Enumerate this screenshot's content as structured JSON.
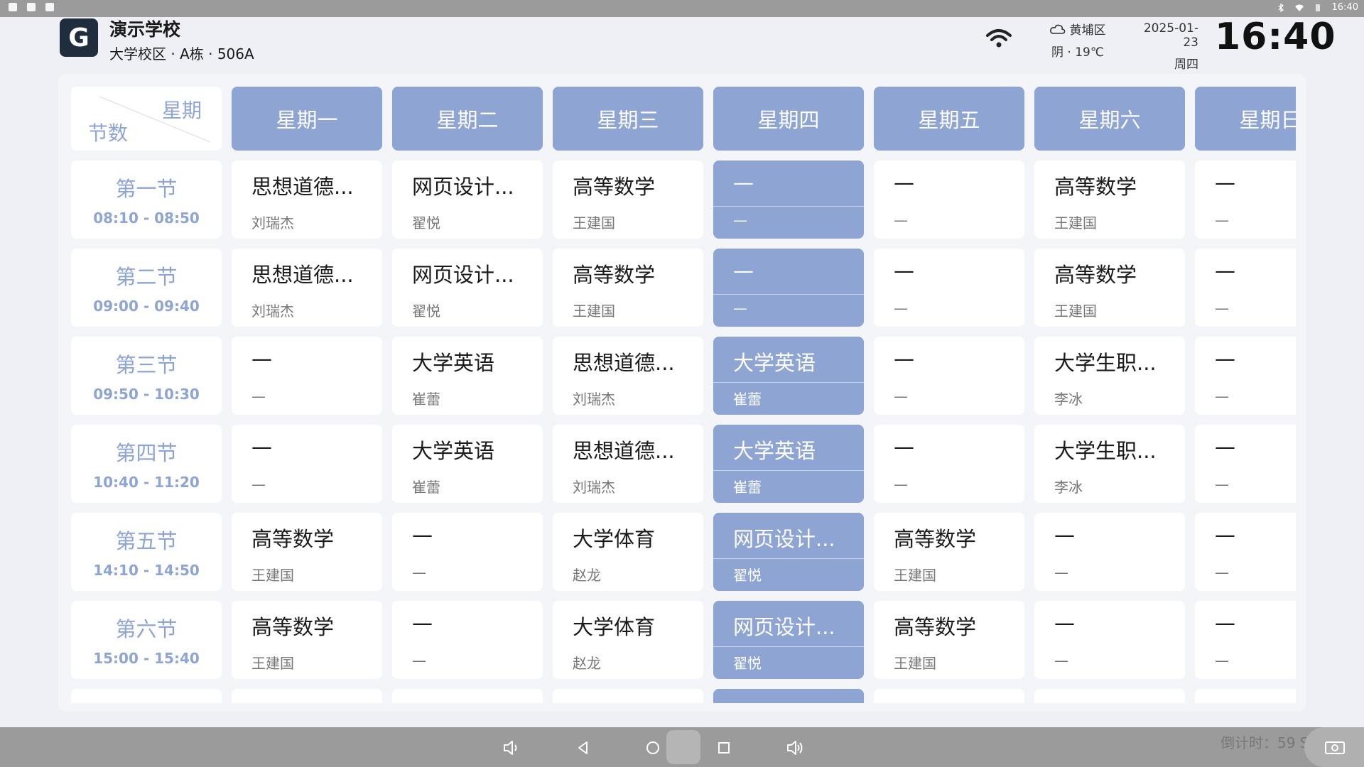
{
  "status_bar": {
    "time": "16:40"
  },
  "header": {
    "logo_letter": "G",
    "school_name": "演示学校",
    "location": "大学校区 · A栋 · 506A",
    "weather": {
      "district": "黄埔区",
      "condition": "阴 · 19℃"
    },
    "date": "2025-01-23",
    "weekday": "周四",
    "clock": "16:40"
  },
  "timetable": {
    "corner_top": "星期",
    "corner_bottom": "节数",
    "days": [
      "星期一",
      "星期二",
      "星期三",
      "星期四",
      "星期五",
      "星期六",
      "星期日"
    ],
    "today_index": 3,
    "periods": [
      {
        "name": "第一节",
        "time": "08:10 - 08:50",
        "cells": [
          {
            "course": "思想道德...",
            "teacher": "刘瑞杰"
          },
          {
            "course": "网页设计...",
            "teacher": "翟悦"
          },
          {
            "course": "高等数学",
            "teacher": "王建国"
          },
          {
            "course": "—",
            "teacher": "—"
          },
          {
            "course": "—",
            "teacher": "—"
          },
          {
            "course": "高等数学",
            "teacher": "王建国"
          },
          {
            "course": "—",
            "teacher": "—"
          }
        ]
      },
      {
        "name": "第二节",
        "time": "09:00 - 09:40",
        "cells": [
          {
            "course": "思想道德...",
            "teacher": "刘瑞杰"
          },
          {
            "course": "网页设计...",
            "teacher": "翟悦"
          },
          {
            "course": "高等数学",
            "teacher": "王建国"
          },
          {
            "course": "—",
            "teacher": "—"
          },
          {
            "course": "—",
            "teacher": "—"
          },
          {
            "course": "高等数学",
            "teacher": "王建国"
          },
          {
            "course": "—",
            "teacher": "—"
          }
        ]
      },
      {
        "name": "第三节",
        "time": "09:50 - 10:30",
        "cells": [
          {
            "course": "—",
            "teacher": "—"
          },
          {
            "course": "大学英语",
            "teacher": "崔蕾"
          },
          {
            "course": "思想道德...",
            "teacher": "刘瑞杰"
          },
          {
            "course": "大学英语",
            "teacher": "崔蕾"
          },
          {
            "course": "—",
            "teacher": "—"
          },
          {
            "course": "大学生职...",
            "teacher": "李冰"
          },
          {
            "course": "—",
            "teacher": "—"
          }
        ]
      },
      {
        "name": "第四节",
        "time": "10:40 - 11:20",
        "cells": [
          {
            "course": "—",
            "teacher": "—"
          },
          {
            "course": "大学英语",
            "teacher": "崔蕾"
          },
          {
            "course": "思想道德...",
            "teacher": "刘瑞杰"
          },
          {
            "course": "大学英语",
            "teacher": "崔蕾"
          },
          {
            "course": "—",
            "teacher": "—"
          },
          {
            "course": "大学生职...",
            "teacher": "李冰"
          },
          {
            "course": "—",
            "teacher": "—"
          }
        ]
      },
      {
        "name": "第五节",
        "time": "14:10 - 14:50",
        "cells": [
          {
            "course": "高等数学",
            "teacher": "王建国"
          },
          {
            "course": "—",
            "teacher": "—"
          },
          {
            "course": "大学体育",
            "teacher": "赵龙"
          },
          {
            "course": "网页设计...",
            "teacher": "翟悦"
          },
          {
            "course": "高等数学",
            "teacher": "王建国"
          },
          {
            "course": "—",
            "teacher": "—"
          },
          {
            "course": "—",
            "teacher": "—"
          }
        ]
      },
      {
        "name": "第六节",
        "time": "15:00 - 15:40",
        "cells": [
          {
            "course": "高等数学",
            "teacher": "王建国"
          },
          {
            "course": "—",
            "teacher": "—"
          },
          {
            "course": "大学体育",
            "teacher": "赵龙"
          },
          {
            "course": "网页设计...",
            "teacher": "翟悦"
          },
          {
            "course": "高等数学",
            "teacher": "王建国"
          },
          {
            "course": "—",
            "teacher": "—"
          },
          {
            "course": "—",
            "teacher": "—"
          }
        ]
      }
    ]
  },
  "footer": {
    "countdown": "倒计时：59 S"
  },
  "colors": {
    "accent": "#8ea4d2",
    "panel": "#f4f5f8",
    "background": "#eef0f5"
  }
}
